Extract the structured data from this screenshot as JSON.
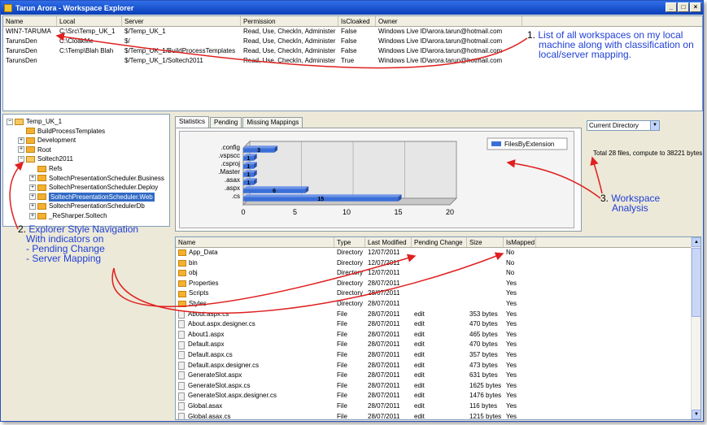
{
  "window": {
    "title": "Tarun Arora - Workspace Explorer"
  },
  "workspaces": {
    "columns": [
      "Name",
      "Local",
      "Server",
      "Permission",
      "IsCloaked",
      "Owner"
    ],
    "rows": [
      [
        "WIN7-TARUMA",
        "C:\\Src\\Temp_UK_1",
        "$/Temp_UK_1",
        "Read, Use, CheckIn, Administer",
        "False",
        "Windows Live ID\\arora.tarun@hotmail.com"
      ],
      [
        "TarunsDen",
        "C:\\CloakMe",
        "$/",
        "Read, Use, CheckIn, Administer",
        "False",
        "Windows Live ID\\arora.tarun@hotmail.com"
      ],
      [
        "TarunsDen",
        "C:\\Temp\\Blah Blah",
        "$/Temp_UK_1/BuildProcessTemplates",
        "Read, Use, CheckIn, Administer",
        "False",
        "Windows Live ID\\arora.tarun@hotmail.com"
      ],
      [
        "TarunsDen",
        "",
        "$/Temp_UK_1/Soltech2011",
        "Read, Use, CheckIn, Administer",
        "True",
        "Windows Live ID\\arora.tarun@hotmail.com"
      ]
    ]
  },
  "tree": {
    "nodes": [
      {
        "label": "Temp_UK_1",
        "toggle": "−",
        "level": 0
      },
      {
        "label": "BuildProcessTemplates",
        "toggle": "",
        "level": 1
      },
      {
        "label": "Development",
        "toggle": "+",
        "level": 1
      },
      {
        "label": "Root",
        "toggle": "+",
        "level": 1
      },
      {
        "label": "Soltech2011",
        "toggle": "−",
        "level": 1
      },
      {
        "label": "Refs",
        "toggle": "",
        "level": 2
      },
      {
        "label": "SoltechPresentationScheduler.Business",
        "toggle": "+",
        "level": 2
      },
      {
        "label": "SoltechPresentationScheduler.Deploy",
        "toggle": "+",
        "level": 2
      },
      {
        "label": "SoltechPresentationScheduler.Web",
        "toggle": "+",
        "level": 2,
        "selected": true
      },
      {
        "label": "SoltechPresentationSchedulerDb",
        "toggle": "+",
        "level": 2
      },
      {
        "label": "_ReSharper.Soltech",
        "toggle": "+",
        "level": 2
      }
    ]
  },
  "tabs": [
    "Statistics",
    "Pending",
    "Missing Mappings"
  ],
  "dropdown": {
    "value": "Current Directory"
  },
  "total_text": "Total 28 files, compute to 38221 bytes",
  "chart_data": {
    "type": "bar",
    "orientation": "horizontal",
    "categories": [
      ".config",
      ".vspscc",
      ".csproj",
      ".Master",
      ".asax",
      ".aspx",
      ".cs"
    ],
    "series": [
      {
        "name": "FilesByExtension",
        "values": [
          3,
          1,
          1,
          1,
          1,
          6,
          15
        ]
      }
    ],
    "xlim": [
      0,
      20
    ],
    "xticks": [
      "0",
      "5",
      "10",
      "15",
      "20"
    ],
    "legend_position": "top-right",
    "color": "#3a6fd8"
  },
  "files": {
    "columns": [
      "Name",
      "Type",
      "Last Modified",
      "Pending Change",
      "Size",
      "IsMapped"
    ],
    "rows": [
      {
        "name": "App_Data",
        "icon": "folder",
        "type": "Directory",
        "mod": "12/07/2011",
        "pend": "",
        "size": "",
        "map": "No"
      },
      {
        "name": "bin",
        "icon": "folder",
        "type": "Directory",
        "mod": "12/07/2011",
        "pend": "",
        "size": "",
        "map": "No"
      },
      {
        "name": "obj",
        "icon": "folder",
        "type": "Directory",
        "mod": "12/07/2011",
        "pend": "",
        "size": "",
        "map": "No"
      },
      {
        "name": "Properties",
        "icon": "folder",
        "type": "Directory",
        "mod": "28/07/2011",
        "pend": "",
        "size": "",
        "map": "Yes"
      },
      {
        "name": "Scripts",
        "icon": "folder",
        "type": "Directory",
        "mod": "28/07/2011",
        "pend": "",
        "size": "",
        "map": "Yes"
      },
      {
        "name": "Styles",
        "icon": "folder",
        "type": "Directory",
        "mod": "28/07/2011",
        "pend": "",
        "size": "",
        "map": "Yes"
      },
      {
        "name": "About.aspx.cs",
        "icon": "file",
        "type": "File",
        "mod": "28/07/2011",
        "pend": "edit",
        "size": "353 bytes",
        "map": "Yes"
      },
      {
        "name": "About.aspx.designer.cs",
        "icon": "file",
        "type": "File",
        "mod": "28/07/2011",
        "pend": "edit",
        "size": "470 bytes",
        "map": "Yes"
      },
      {
        "name": "About1.aspx",
        "icon": "file",
        "type": "File",
        "mod": "28/07/2011",
        "pend": "edit",
        "size": "465 bytes",
        "map": "Yes"
      },
      {
        "name": "Default.aspx",
        "icon": "file",
        "type": "File",
        "mod": "28/07/2011",
        "pend": "edit",
        "size": "470 bytes",
        "map": "Yes"
      },
      {
        "name": "Default.aspx.cs",
        "icon": "file",
        "type": "File",
        "mod": "28/07/2011",
        "pend": "edit",
        "size": "357 bytes",
        "map": "Yes"
      },
      {
        "name": "Default.aspx.designer.cs",
        "icon": "file",
        "type": "File",
        "mod": "28/07/2011",
        "pend": "edit",
        "size": "473 bytes",
        "map": "Yes"
      },
      {
        "name": "GenerateSlot.aspx",
        "icon": "file",
        "type": "File",
        "mod": "28/07/2011",
        "pend": "edit",
        "size": "631 bytes",
        "map": "Yes"
      },
      {
        "name": "GenerateSlot.aspx.cs",
        "icon": "file",
        "type": "File",
        "mod": "28/07/2011",
        "pend": "edit",
        "size": "1625 bytes",
        "map": "Yes"
      },
      {
        "name": "GenerateSlot.aspx.designer.cs",
        "icon": "file",
        "type": "File",
        "mod": "28/07/2011",
        "pend": "edit",
        "size": "1476 bytes",
        "map": "Yes"
      },
      {
        "name": "Global.asax",
        "icon": "file",
        "type": "File",
        "mod": "28/07/2011",
        "pend": "edit",
        "size": "116 bytes",
        "map": "Yes"
      },
      {
        "name": "Global.asax.cs",
        "icon": "file",
        "type": "File",
        "mod": "28/07/2011",
        "pend": "edit",
        "size": "1215 bytes",
        "map": "Yes"
      }
    ]
  },
  "annotations": {
    "a1_num": "1.",
    "a1_lines": [
      "List of all workspaces on my local",
      "machine along with classification on",
      "local/server mapping."
    ],
    "a2_num": "2.",
    "a2_lines": [
      "Explorer Style Navigation",
      "With indicators on",
      "- Pending Change",
      "- Server Mapping"
    ],
    "a3_num": "3.",
    "a3_lines": [
      "Workspace",
      "Analysis"
    ]
  }
}
